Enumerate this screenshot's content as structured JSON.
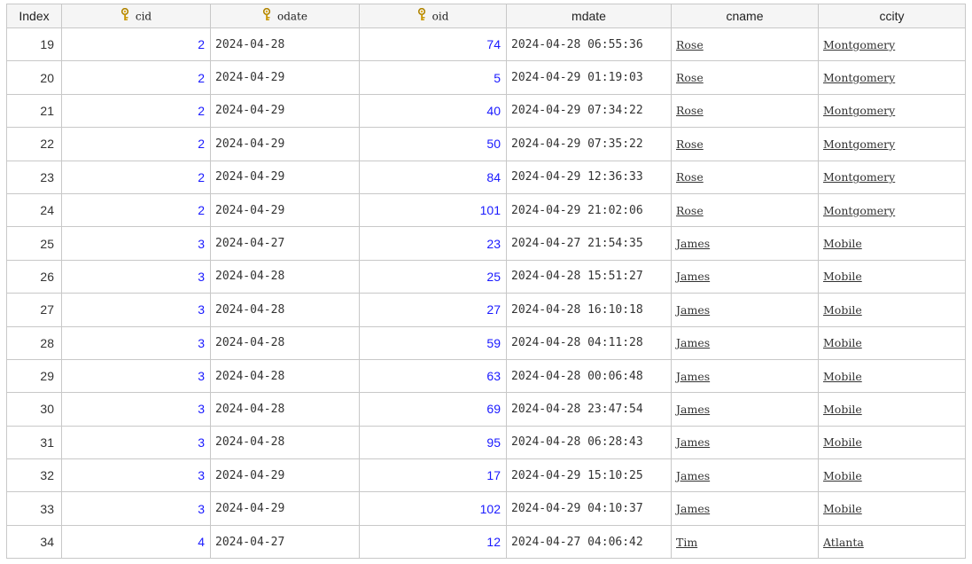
{
  "columns": [
    {
      "label": "Index",
      "key": false
    },
    {
      "label": "cid",
      "key": true
    },
    {
      "label": "odate",
      "key": true
    },
    {
      "label": "oid",
      "key": true
    },
    {
      "label": "mdate",
      "key": false
    },
    {
      "label": "cname",
      "key": false
    },
    {
      "label": "ccity",
      "key": false
    }
  ],
  "colors": {
    "number": "#1a1aff",
    "key_icon": "#e0a800",
    "grid": "#c8c8c8"
  },
  "rows": [
    {
      "index": "19",
      "cid": "2",
      "odate": "2024-04-28",
      "oid": "74",
      "mdate": "2024-04-28 06:55:36",
      "cname": "Rose",
      "ccity": "Montgomery"
    },
    {
      "index": "20",
      "cid": "2",
      "odate": "2024-04-29",
      "oid": "5",
      "mdate": "2024-04-29 01:19:03",
      "cname": "Rose",
      "ccity": "Montgomery"
    },
    {
      "index": "21",
      "cid": "2",
      "odate": "2024-04-29",
      "oid": "40",
      "mdate": "2024-04-29 07:34:22",
      "cname": "Rose",
      "ccity": "Montgomery"
    },
    {
      "index": "22",
      "cid": "2",
      "odate": "2024-04-29",
      "oid": "50",
      "mdate": "2024-04-29 07:35:22",
      "cname": "Rose",
      "ccity": "Montgomery"
    },
    {
      "index": "23",
      "cid": "2",
      "odate": "2024-04-29",
      "oid": "84",
      "mdate": "2024-04-29 12:36:33",
      "cname": "Rose",
      "ccity": "Montgomery"
    },
    {
      "index": "24",
      "cid": "2",
      "odate": "2024-04-29",
      "oid": "101",
      "mdate": "2024-04-29 21:02:06",
      "cname": "Rose",
      "ccity": "Montgomery"
    },
    {
      "index": "25",
      "cid": "3",
      "odate": "2024-04-27",
      "oid": "23",
      "mdate": "2024-04-27 21:54:35",
      "cname": "James",
      "ccity": "Mobile"
    },
    {
      "index": "26",
      "cid": "3",
      "odate": "2024-04-28",
      "oid": "25",
      "mdate": "2024-04-28 15:51:27",
      "cname": "James",
      "ccity": "Mobile"
    },
    {
      "index": "27",
      "cid": "3",
      "odate": "2024-04-28",
      "oid": "27",
      "mdate": "2024-04-28 16:10:18",
      "cname": "James",
      "ccity": "Mobile"
    },
    {
      "index": "28",
      "cid": "3",
      "odate": "2024-04-28",
      "oid": "59",
      "mdate": "2024-04-28 04:11:28",
      "cname": "James",
      "ccity": "Mobile"
    },
    {
      "index": "29",
      "cid": "3",
      "odate": "2024-04-28",
      "oid": "63",
      "mdate": "2024-04-28 00:06:48",
      "cname": "James",
      "ccity": "Mobile"
    },
    {
      "index": "30",
      "cid": "3",
      "odate": "2024-04-28",
      "oid": "69",
      "mdate": "2024-04-28 23:47:54",
      "cname": "James",
      "ccity": "Mobile"
    },
    {
      "index": "31",
      "cid": "3",
      "odate": "2024-04-28",
      "oid": "95",
      "mdate": "2024-04-28 06:28:43",
      "cname": "James",
      "ccity": "Mobile"
    },
    {
      "index": "32",
      "cid": "3",
      "odate": "2024-04-29",
      "oid": "17",
      "mdate": "2024-04-29 15:10:25",
      "cname": "James",
      "ccity": "Mobile"
    },
    {
      "index": "33",
      "cid": "3",
      "odate": "2024-04-29",
      "oid": "102",
      "mdate": "2024-04-29 04:10:37",
      "cname": "James",
      "ccity": "Mobile"
    },
    {
      "index": "34",
      "cid": "4",
      "odate": "2024-04-27",
      "oid": "12",
      "mdate": "2024-04-27 04:06:42",
      "cname": "Tim",
      "ccity": "Atlanta"
    }
  ]
}
